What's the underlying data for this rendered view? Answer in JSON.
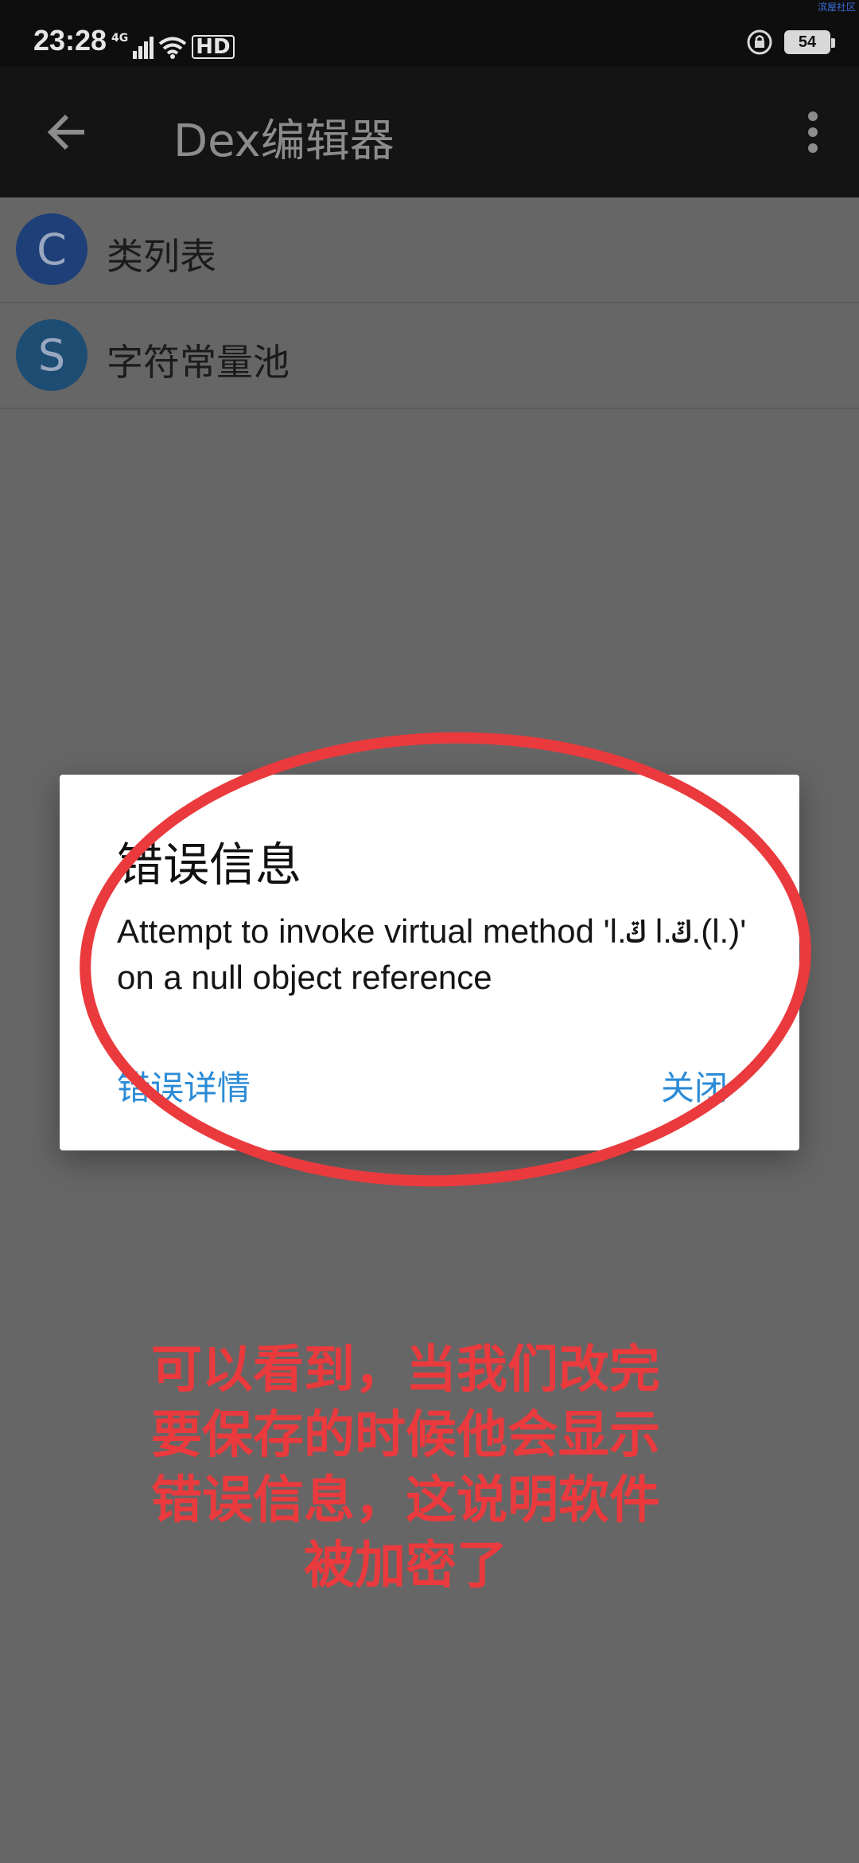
{
  "status": {
    "time": "23:28",
    "network": "4G",
    "hd": "HD",
    "battery": "54",
    "watermark": "滨屋社区"
  },
  "toolbar": {
    "title": "Dex编辑器"
  },
  "list": {
    "items": [
      {
        "avatar": "C",
        "label": "类列表"
      },
      {
        "avatar": "S",
        "label": "字符常量池"
      }
    ]
  },
  "dialog": {
    "title": "错误信息",
    "message": "Attempt to invoke virtual method 'l.ݿ l.ݿ.(l.)' on a null object reference",
    "details_label": "错误详情",
    "close_label": "关闭"
  },
  "annotation": {
    "lines": [
      "可以看到，当我们改完",
      "要保存的时候他会显示",
      "错误信息，这说明软件",
      "被加密了"
    ],
    "color": "#ea3a3d"
  }
}
